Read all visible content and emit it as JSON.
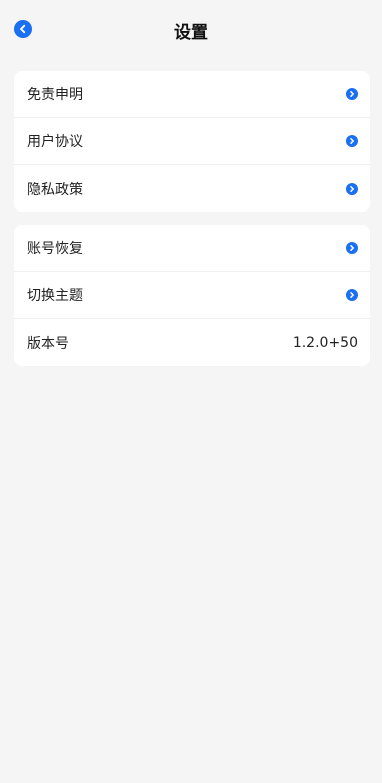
{
  "header": {
    "title": "设置"
  },
  "groups": [
    {
      "items": [
        {
          "label": "免责申明",
          "icon": "chevron-right-circle-icon"
        },
        {
          "label": "用户协议",
          "icon": "chevron-right-circle-icon"
        },
        {
          "label": "隐私政策",
          "icon": "chevron-right-circle-icon"
        }
      ]
    },
    {
      "items": [
        {
          "label": "账号恢复",
          "icon": "chevron-right-circle-icon"
        },
        {
          "label": "切换主题",
          "icon": "chevron-right-circle-icon"
        },
        {
          "label": "版本号",
          "value": "1.2.0+50"
        }
      ]
    }
  ],
  "colors": {
    "accent": "#1a6ff3",
    "background": "#f5f5f5",
    "card": "#ffffff"
  }
}
